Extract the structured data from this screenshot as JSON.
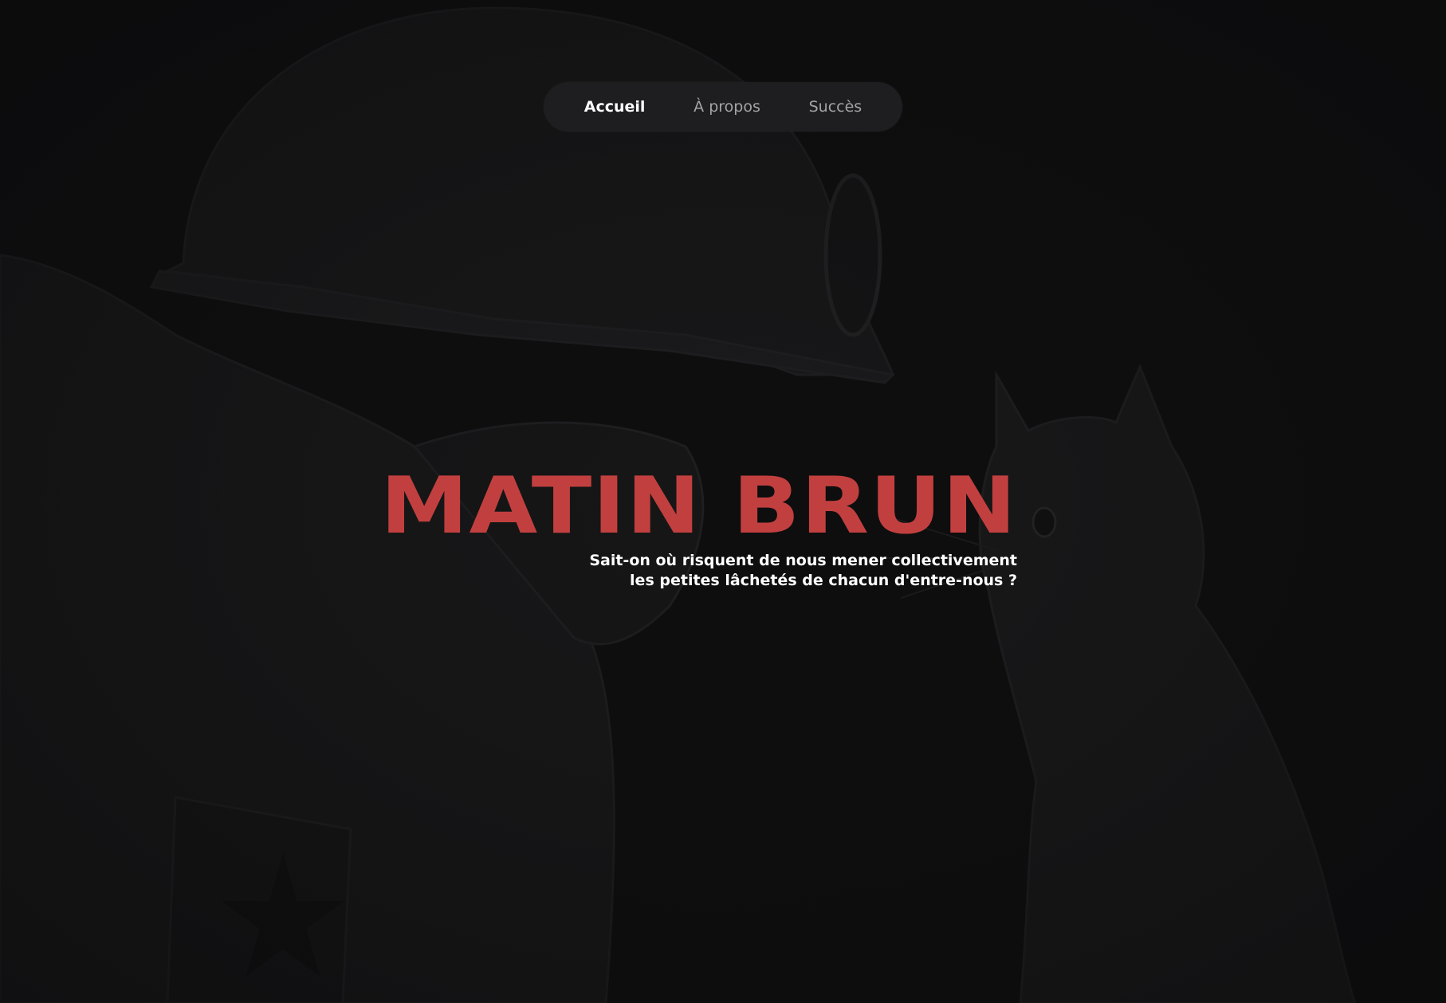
{
  "nav": {
    "items": [
      {
        "label": "Accueil",
        "active": true
      },
      {
        "label": "À propos",
        "active": false
      },
      {
        "label": "Succès",
        "active": false
      }
    ]
  },
  "hero": {
    "title": "MATIN BRUN",
    "subtitle_line1": "Sait-on où risquent de nous mener collectivement",
    "subtitle_line2": "les petites lâchetés de chacun d'entre-nous ?"
  },
  "colors": {
    "background": "#0e0e0f",
    "nav_background": "#1e1e20",
    "title": "#c1403f",
    "subtitle": "#ffffff",
    "nav_inactive": "#a4a4a6"
  },
  "background_art": {
    "icon": "soldier-and-cat-illustration"
  }
}
